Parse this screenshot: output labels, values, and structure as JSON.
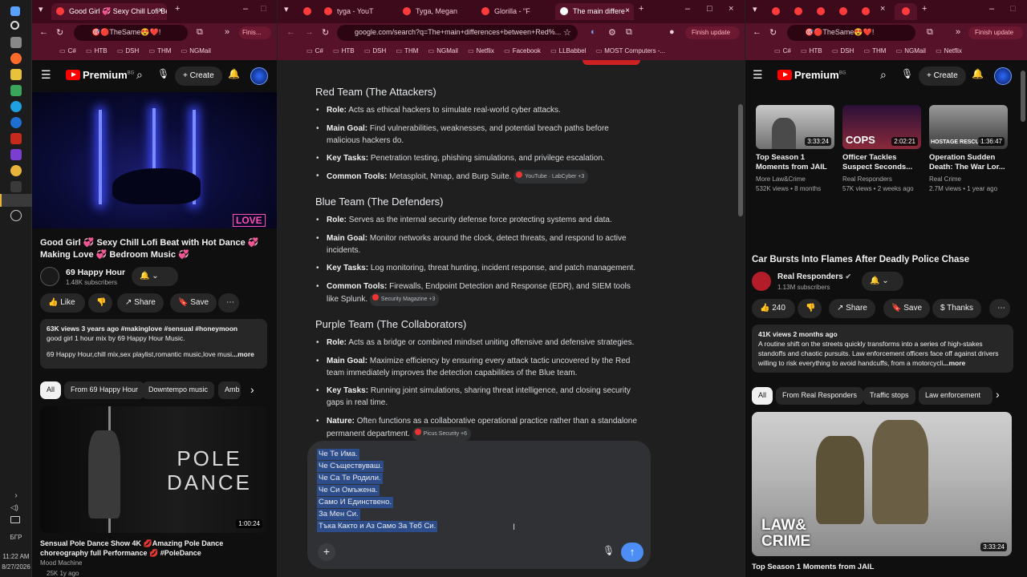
{
  "taskbar": {
    "time": "11:22 AM",
    "date": "8/27/2026",
    "lang": "БГР"
  },
  "left": {
    "tabs": [
      {
        "title": "Good Girl 💞 Sexy Chill Lofi Be"
      }
    ],
    "omnibox": "🎯🔴TheSame😍❤️!",
    "finish_label": "Finis...",
    "bookmarks": [
      "C#",
      "HTB",
      "DSH",
      "THM",
      "NGMail"
    ],
    "yt": {
      "logo": "Premium",
      "logo_region": "BG",
      "create_label": "Create",
      "video_title": "Good Girl 💞 Sexy Chill Lofi Beat with Hot Dance 💞 Making Love 💞 Bedroom Music 💞",
      "channel": "69 Happy Hour",
      "subs": "1.48K subscribers",
      "like": "Like",
      "share": "Share",
      "save": "Save",
      "desc_meta": "63K views  3 years ago  #makinglove #sensual #honeymoon",
      "desc_line1": "good girl 1 hour mix by 69 Happy Hour Music.",
      "desc_line2": "69 Happy Hour,chill mix,sex playlist,romantic music,love musi",
      "more": "...more",
      "chips": [
        "All",
        "From 69 Happy Hour",
        "Downtempo music",
        "Amb"
      ],
      "thumb_text": "POLE\nDANCE",
      "thumb_line1": "POLE",
      "thumb_line2": "DANCE",
      "rec_duration": "1:00:24",
      "rec_title": "Sensual Pole Dance Show 4K 💋Amazing Pole Dance choreography full Performance 💋 #PoleDance",
      "rec_channel": "Mood Machine",
      "rec_meta": "25K  1y ago",
      "love_badge": "LOVE"
    }
  },
  "middle": {
    "tabs": [
      {
        "title": "tyga - YouT"
      },
      {
        "title": "Tyga, Megan"
      },
      {
        "title": "Glorilla - \"F"
      },
      {
        "title": "The main differe"
      }
    ],
    "omnibox": "google.com/search?q=The+main+differences+between+Red%...",
    "finish_label": "Finish update",
    "bookmarks": [
      "C#",
      "HTB",
      "DSH",
      "THM",
      "NGMail",
      "Netflix",
      "Facebook",
      "LLBabbel",
      "MOST Computers -..."
    ],
    "sections": [
      {
        "heading": "Red Team (The Attackers)",
        "items": [
          {
            "label": "Role:",
            "text": "Acts as ethical hackers to simulate real-world cyber attacks.",
            "src": ""
          },
          {
            "label": "Main Goal:",
            "text": "Find vulnerabilities, weaknesses, and potential breach paths before malicious hackers do.",
            "src": ""
          },
          {
            "label": "Key Tasks:",
            "text": "Penetration testing, phishing simulations, and privilege escalation.",
            "src": ""
          },
          {
            "label": "Common Tools:",
            "text": "Metasploit, Nmap, and Burp Suite.",
            "src": "YouTube · LabCyber +3"
          }
        ]
      },
      {
        "heading": "Blue Team (The Defenders)",
        "items": [
          {
            "label": "Role:",
            "text": "Serves as the internal security defense force protecting systems and data.",
            "src": ""
          },
          {
            "label": "Main Goal:",
            "text": "Monitor networks around the clock, detect threats, and respond to active incidents.",
            "src": ""
          },
          {
            "label": "Key Tasks:",
            "text": "Log monitoring, threat hunting, incident response, and patch management.",
            "src": ""
          },
          {
            "label": "Common Tools:",
            "text": "Firewalls, Endpoint Detection and Response (EDR), and SIEM tools like Splunk.",
            "src": "Security Magazine +3"
          }
        ]
      },
      {
        "heading": "Purple Team (The Collaborators)",
        "items": [
          {
            "label": "Role:",
            "text": "Acts as a bridge or combined mindset uniting offensive and defensive strategies.",
            "src": ""
          },
          {
            "label": "Main Goal:",
            "text": "Maximize efficiency by ensuring every attack tactic uncovered by the Red team immediately improves the detection capabilities of the Blue team.",
            "src": ""
          },
          {
            "label": "Key Tasks:",
            "text": "Running joint simulations, sharing threat intelligence, and closing security gaps in real time.",
            "src": ""
          },
          {
            "label": "Nature:",
            "text": "Often functions as a collaborative operational practice rather than a standalone permanent department.",
            "src": "Picus Security +6"
          }
        ]
      }
    ],
    "composer_lines": [
      "Че Те Има.",
      "Че Съществуваш.",
      "Че Са Те Родили.",
      "Че Си Омъжена.",
      "Само И Единствено.",
      "За Мен Си.",
      "Тъка Както и Аз Само За Теб Си."
    ]
  },
  "right": {
    "omnibox": "🎯🔴TheSame😍❤️!",
    "finish_label": "Finish update",
    "bookmarks": [
      "C#",
      "HTB",
      "DSH",
      "THM",
      "NGMail",
      "Netflix"
    ],
    "yt": {
      "logo": "Premium",
      "logo_region": "BG",
      "create_label": "Create",
      "shorts": [
        {
          "title": "Top Season 1 Moments from JAIL",
          "channel": "More Law&Crime",
          "meta": "532K views • 8 months",
          "duration": "3:33:24"
        },
        {
          "title": "Officer Tackles Suspect Seconds...",
          "channel": "Real Responders",
          "meta": "57K views • 2 weeks ago",
          "duration": "2:02:21"
        },
        {
          "title": "Operation Sudden Death: The War Lor...",
          "channel": "Real Crime",
          "meta": "2.7M views • 1 year ago",
          "duration": "1:36:47"
        }
      ],
      "thumb3_label": "HOSTAGE RESCUE",
      "thumb2_label": "COPS",
      "video_title": "Car Bursts Into Flames After Deadly Police Chase",
      "channel": "Real Responders",
      "subs": "1.13M subscribers",
      "likes": "240",
      "share": "Share",
      "save": "Save",
      "thanks": "Thanks",
      "desc_meta": "41K views  2 months ago",
      "desc_text": "A routine shift on the streets quickly transforms into a series of high-stakes standoffs and chaotic pursuits. Law enforcement officers face off against drivers willing to risk everything to avoid handcuffs, from a motorcycli",
      "more": "...more",
      "chips": [
        "All",
        "From Real Responders",
        "Traffic stops",
        "Law enforcement"
      ],
      "rec_duration": "3:33:24",
      "rec_title": "Top Season 1 Moments from JAIL",
      "rec_brand": "LAW&\nCRIME",
      "rec_brand1": "LAW&",
      "rec_brand2": "CRIME"
    }
  }
}
